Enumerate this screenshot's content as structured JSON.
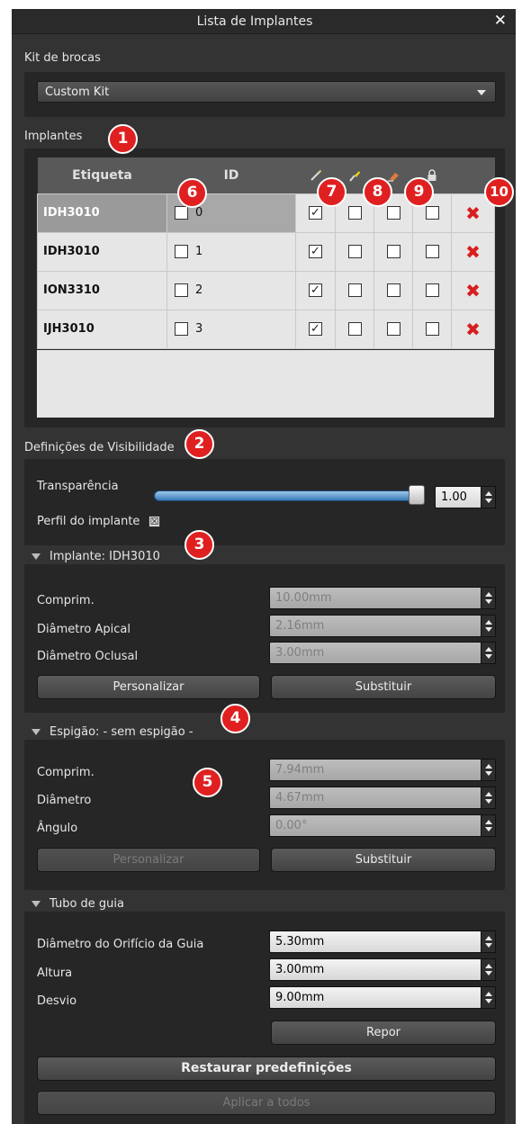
{
  "window": {
    "title": "Lista de Implantes",
    "close_glyph": "✕"
  },
  "drill_kit": {
    "label": "Kit de brocas",
    "selected": "Custom Kit"
  },
  "implants": {
    "label": "Implantes",
    "columns": {
      "label": "Etiqueta",
      "id": "ID"
    },
    "header_icons": [
      "pencil-icon",
      "brush-icon",
      "eraser-icon",
      "lock-icon"
    ],
    "rows": [
      {
        "label": "IDH3010",
        "id": "0",
        "visible": true,
        "color": false,
        "hide": false,
        "lock": false,
        "selected": true
      },
      {
        "label": "IDH3010",
        "id": "1",
        "visible": true,
        "color": false,
        "hide": false,
        "lock": false,
        "selected": false
      },
      {
        "label": "ION3310",
        "id": "2",
        "visible": true,
        "color": false,
        "hide": false,
        "lock": false,
        "selected": false
      },
      {
        "label": "IJH3010",
        "id": "3",
        "visible": true,
        "color": false,
        "hide": false,
        "lock": false,
        "selected": false
      }
    ]
  },
  "visibility": {
    "label": "Definições de Visibilidade",
    "transparency_label": "Transparência",
    "transparency_value": "1.00",
    "transparency_fraction": 1.0,
    "profile_label": "Perfil do implante"
  },
  "implant_section": {
    "title": "Implante: IDH3010",
    "fields": [
      {
        "label": "Comprim.",
        "value": "10.00mm"
      },
      {
        "label": "Diâmetro Apical",
        "value": "2.16mm"
      },
      {
        "label": "Diâmetro Oclusal",
        "value": "3.00mm"
      }
    ],
    "customize": "Personalizar",
    "replace": "Substituir"
  },
  "abutment_section": {
    "title": "Espigão: - sem espigão -",
    "fields": [
      {
        "label": "Comprim.",
        "value": "7.94mm"
      },
      {
        "label": "Diâmetro",
        "value": "4.67mm"
      },
      {
        "label": "Ângulo",
        "value": "0.00°"
      }
    ],
    "customize": "Personalizar",
    "replace": "Substituir"
  },
  "guide_section": {
    "title": "Tubo de guia",
    "fields": [
      {
        "label": "Diâmetro do Orifício da Guia",
        "value": "5.30mm"
      },
      {
        "label": "Altura",
        "value": "3.00mm"
      },
      {
        "label": "Desvio",
        "value": "9.00mm"
      }
    ],
    "reset": "Repor"
  },
  "restore_defaults": "Restaurar predefinições",
  "apply_all": "Aplicar a todos",
  "badges": [
    "1",
    "2",
    "3",
    "4",
    "5",
    "6",
    "7",
    "8",
    "9",
    "10"
  ],
  "colors": {
    "badge": "#e02020",
    "delete": "#d81e1e",
    "panel": "#333333"
  }
}
